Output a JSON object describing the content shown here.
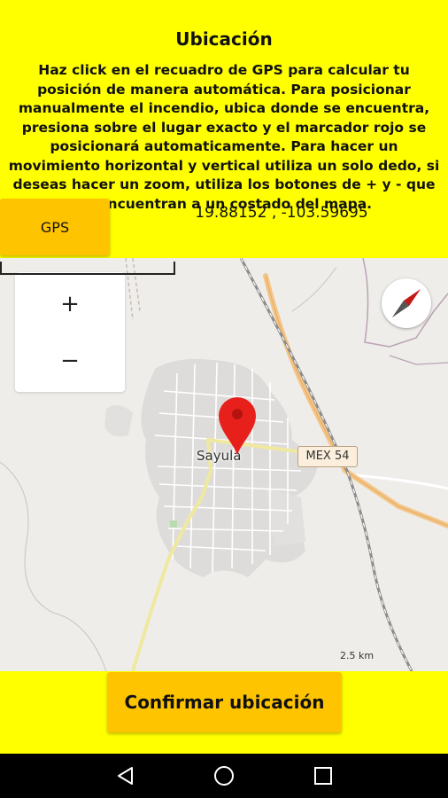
{
  "header": {
    "title": "Ubicación",
    "instructions": "Haz click en el recuadro de GPS para calcular tu posición de manera automática. Para posicionar manualmente el incendio, ubica donde se encuentra, presiona sobre el lugar exacto y el marcador rojo se posicionará automaticamente. Para hacer un movimiento  horizontal y vertical utiliza un solo dedo, si deseas hacer un zoom, utiliza los botones de + y - que se encuentran a un costado del mapa."
  },
  "gps": {
    "button_label": "GPS",
    "coordinates": "19.88152 , -103.59695"
  },
  "map": {
    "zoom_in_label": "+",
    "zoom_out_label": "−",
    "city_label": "Sayula",
    "highway_shield": "MEX 54",
    "scale_label": "2.5 km",
    "compass_icon": "compass-icon",
    "marker_color": "#e8201c"
  },
  "footer": {
    "confirm_label": "Confirmar ubicación"
  },
  "system_nav": {
    "back_icon": "back-triangle-icon",
    "home_icon": "home-circle-icon",
    "recents_icon": "recents-square-icon"
  },
  "colors": {
    "background": "#ffff00",
    "button": "#ffc400",
    "map_base": "#efedea"
  }
}
